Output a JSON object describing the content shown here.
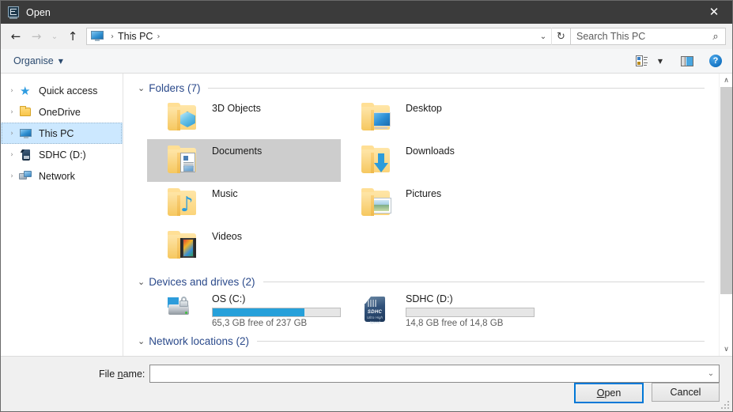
{
  "window": {
    "title": "Open",
    "icon": "app-window-icon",
    "close_label": "✕"
  },
  "address_bar": {
    "back_icon": "←",
    "forward_icon": "→",
    "recent_icon": "⌄",
    "up_icon": "↑",
    "breadcrumb": {
      "root_icon": "this-pc-icon",
      "sep1": "›",
      "path": "This PC",
      "sep2": "›"
    },
    "dropdown_icon": "⌄",
    "refresh_icon": "↻",
    "search": {
      "placeholder": "Search This PC",
      "value": "",
      "icon": "⌕"
    }
  },
  "toolbar": {
    "organise_label": "Organise",
    "organise_caret": "▼",
    "view_icon": "view-layout-icon",
    "view_caret": "▼",
    "preview_pane_icon": "preview-pane-icon",
    "help_label": "?"
  },
  "nav_pane": {
    "items": [
      {
        "label": "Quick access",
        "icon": "star-icon",
        "chevron": "›",
        "selected": false
      },
      {
        "label": "OneDrive",
        "icon": "folder-icon",
        "chevron": "›",
        "selected": false
      },
      {
        "label": "This PC",
        "icon": "this-pc-icon",
        "chevron": "›",
        "selected": true
      },
      {
        "label": "SDHC (D:)",
        "icon": "sd-card-icon",
        "chevron": "›",
        "selected": false
      },
      {
        "label": "Network",
        "icon": "network-icon",
        "chevron": "›",
        "selected": false
      }
    ]
  },
  "content": {
    "groups": [
      {
        "title": "Folders (7)",
        "chevron": "⌄"
      },
      {
        "title": "Devices and drives (2)",
        "chevron": "⌄"
      },
      {
        "title": "Network locations (2)",
        "chevron": "⌄"
      }
    ],
    "folders": [
      {
        "name": "3D Objects",
        "glyph": "cube-glyph",
        "selected": false
      },
      {
        "name": "Desktop",
        "glyph": "monitor-glyph",
        "selected": false
      },
      {
        "name": "Documents",
        "glyph": "document-glyph",
        "selected": true
      },
      {
        "name": "Downloads",
        "glyph": "arrow-glyph",
        "selected": false
      },
      {
        "name": "Music",
        "glyph": "note-glyph",
        "selected": false
      },
      {
        "name": "Pictures",
        "glyph": "picture-glyph",
        "selected": false
      },
      {
        "name": "Videos",
        "glyph": "film-glyph",
        "selected": false
      }
    ],
    "drives": [
      {
        "name": "OS (C:)",
        "icon": "hard-drive-icon",
        "free_text": "65,3 GB free of 237 GB",
        "used_percent": 72
      },
      {
        "name": "SDHC (D:)",
        "icon": "sd-card-icon",
        "free_text": "14,8 GB free of 14,8 GB",
        "used_percent": 0
      }
    ]
  },
  "scrollbar": {
    "up_icon": "∧",
    "down_icon": "∨"
  },
  "footer": {
    "file_name_label_pre": "File ",
    "file_name_label_key": "n",
    "file_name_label_post": "ame:",
    "file_name_value": "",
    "file_name_placeholder": "",
    "combo_caret": "⌄",
    "open_label_pre": "",
    "open_label_key": "O",
    "open_label_post": "pen",
    "cancel_label": "Cancel"
  },
  "colors": {
    "titlebar": "#3b3b3b",
    "accent": "#0078d7",
    "selection_nav": "#cce8ff",
    "selection_tile": "#cdcdcd",
    "group_title": "#2b4a8b",
    "drive_bar_fill": "#26a0da"
  }
}
